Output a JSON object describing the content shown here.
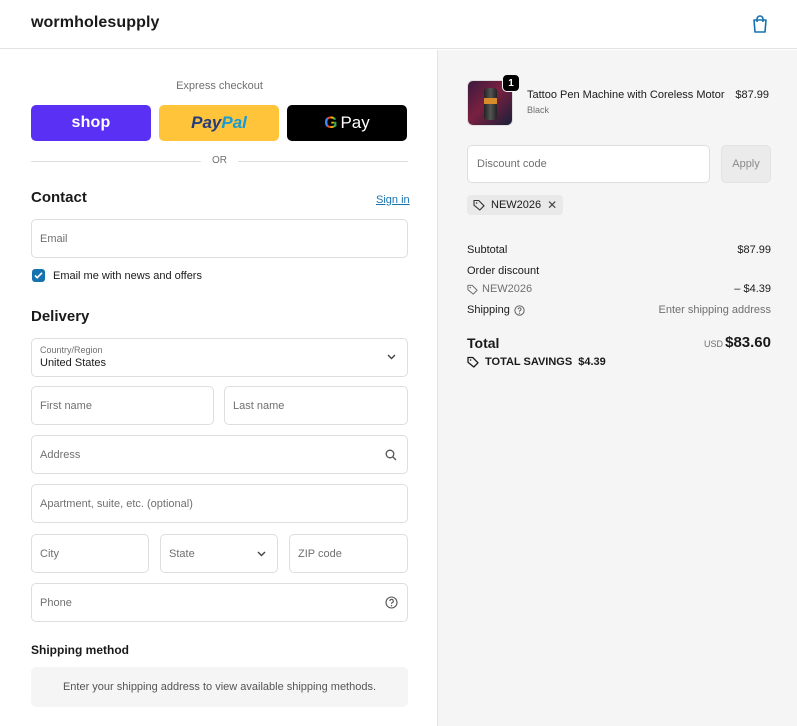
{
  "header": {
    "logo": "wormholesupply",
    "cart_icon": "shopping-bag-icon"
  },
  "express": {
    "label": "Express checkout",
    "shop_label": "shop",
    "paypal_label_1": "Pay",
    "paypal_label_2": "Pal",
    "gpay_g": "G",
    "gpay_label": "Pay",
    "or_label": "OR"
  },
  "contact": {
    "title": "Contact",
    "signin_label": "Sign in",
    "email_placeholder": "Email",
    "newsletter_label": "Email me with news and offers",
    "newsletter_checked": true
  },
  "delivery": {
    "title": "Delivery",
    "country_label": "Country/Region",
    "country_value": "United States",
    "first_name_placeholder": "First name",
    "last_name_placeholder": "Last name",
    "address_placeholder": "Address",
    "apartment_placeholder": "Apartment, suite, etc. (optional)",
    "city_placeholder": "City",
    "state_placeholder": "State",
    "zip_placeholder": "ZIP code",
    "phone_placeholder": "Phone"
  },
  "shipping_method": {
    "title": "Shipping method",
    "note": "Enter your shipping address to view available shipping methods."
  },
  "summary": {
    "item": {
      "name": "Tattoo Pen Machine with Coreless Motor",
      "variant": "Black",
      "price": "$87.99",
      "quantity": "1"
    },
    "discount_placeholder": "Discount code",
    "apply_label": "Apply",
    "applied_code": "NEW2026",
    "subtotal_label": "Subtotal",
    "subtotal_value": "$87.99",
    "order_discount_label": "Order discount",
    "discount_code": "NEW2026",
    "discount_value": "– $4.39",
    "shipping_label": "Shipping",
    "shipping_value": "Enter shipping address",
    "total_label": "Total",
    "total_currency": "USD",
    "total_value": "$83.60",
    "savings_label": "TOTAL SAVINGS",
    "savings_value": "$4.39"
  },
  "colors": {
    "shop": "#5a31f4",
    "paypal": "#ffc439",
    "gpay": "#000000",
    "link": "#1773b0"
  }
}
